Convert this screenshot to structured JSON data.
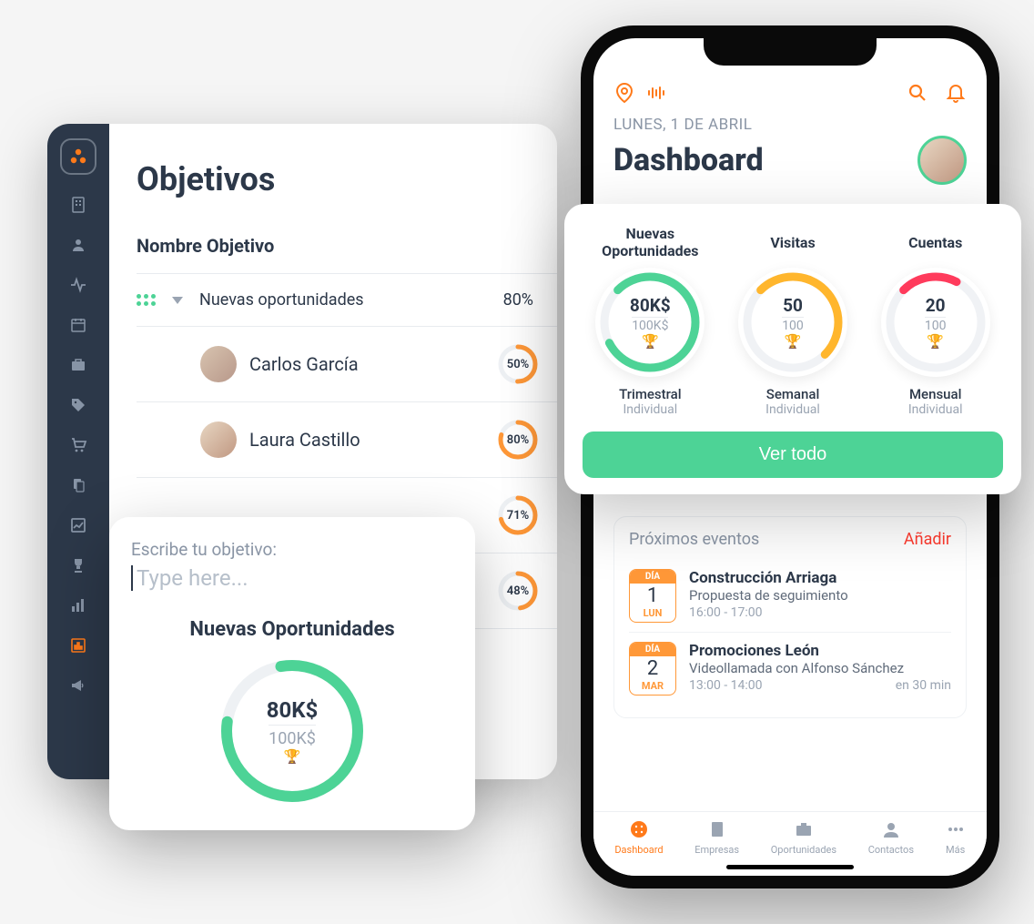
{
  "desktop": {
    "title": "Objetivos",
    "table_header": "Nombre Objetivo",
    "main_goal": {
      "name": "Nuevas oportunidades",
      "percent": "80%"
    },
    "people": [
      {
        "name": "Carlos García",
        "percent": "50%",
        "arc": 50
      },
      {
        "name": "Laura Castillo",
        "percent": "80%",
        "arc": 80
      },
      {
        "name": "",
        "percent": "71%",
        "arc": 71
      },
      {
        "name": "",
        "percent": "48%",
        "arc": 48
      }
    ]
  },
  "popup": {
    "label": "Escribe tu objetivo:",
    "placeholder": "Type here...",
    "heading": "Nuevas Oportunidades",
    "value": "80K$",
    "target": "100K$"
  },
  "phone": {
    "date": "LUNES, 1 DE ABRIL",
    "title": "Dashboard",
    "events_title": "Próximos eventos",
    "add_label": "Añadir",
    "events": [
      {
        "badge_top": "DÍA",
        "day": "1",
        "dow": "LUN",
        "name": "Construcción Arriaga",
        "sub": "Propuesta de seguimiento",
        "time": "16:00 - 17:00",
        "rel": ""
      },
      {
        "badge_top": "DÍA",
        "day": "2",
        "dow": "MAR",
        "name": "Promociones León",
        "sub": "Videollamada con Alfonso Sánchez",
        "time": "13:00 - 14:00",
        "rel": "en 30 min"
      }
    ],
    "tabs": [
      {
        "label": "Dashboard"
      },
      {
        "label": "Empresas"
      },
      {
        "label": "Oportunidades"
      },
      {
        "label": "Contactos"
      },
      {
        "label": "Más"
      }
    ]
  },
  "metrics": {
    "items": [
      {
        "title": "Nuevas Oportunidades",
        "value": "80K$",
        "target": "100K$",
        "period": "Trimestral",
        "scope": "Individual",
        "color": "#4dd396",
        "arc": 80
      },
      {
        "title": "Visitas",
        "value": "50",
        "target": "100",
        "period": "Semanal",
        "scope": "Individual",
        "color": "#ffb62d",
        "arc": 50
      },
      {
        "title": "Cuentas",
        "value": "20",
        "target": "100",
        "period": "Mensual",
        "scope": "Individual",
        "color": "#ff3b5c",
        "arc": 20
      }
    ],
    "button": "Ver todo"
  }
}
